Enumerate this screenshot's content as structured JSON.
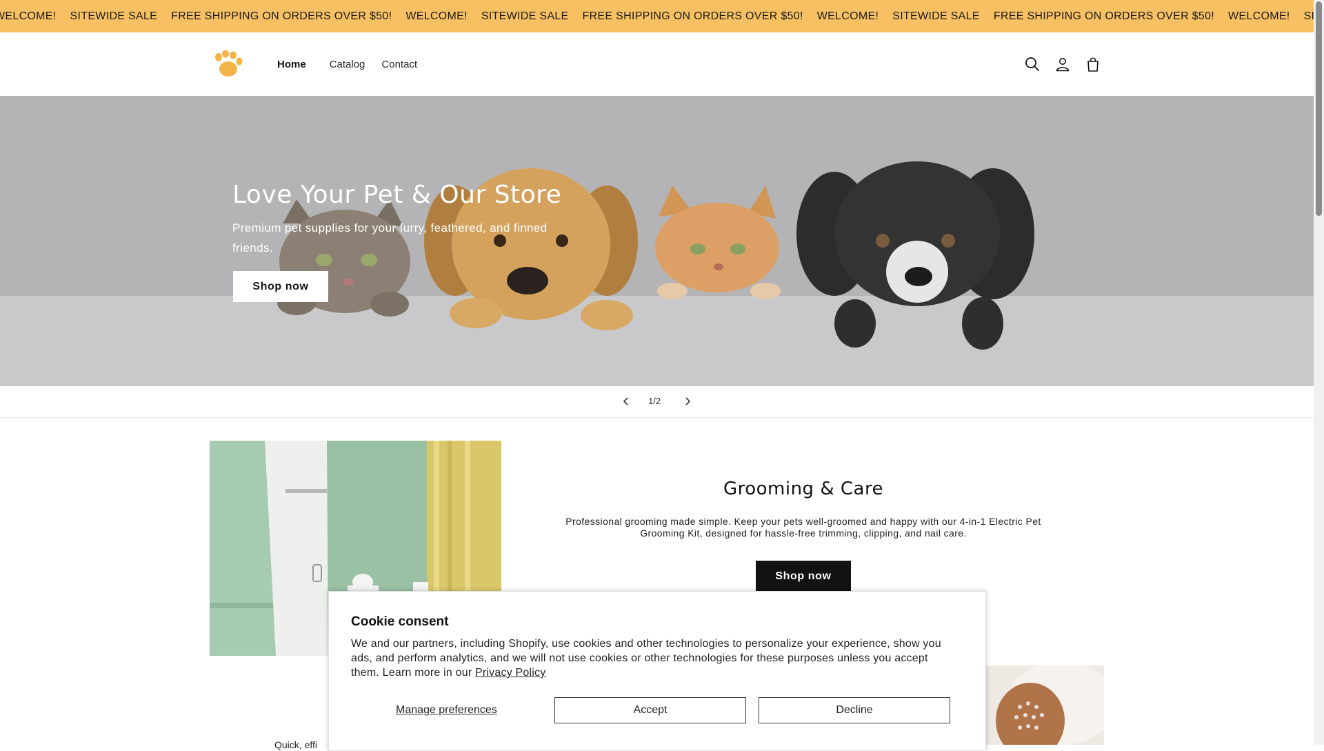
{
  "announcement": {
    "items": [
      "WELCOME!",
      "SITEWIDE SALE",
      "FREE SHIPPING ON ORDERS OVER $50!",
      "WELCOME!",
      "SITEWIDE SALE",
      "FREE SHIPPING ON ORDERS OVER $50!",
      "WELCOME!",
      "SITEWIDE SALE",
      "FREE SHIPPING ON ORDERS OVER $50!",
      "WELCOME!",
      "SITEWIDE SALE",
      "FREE SHIPPING ON ORDERS OVER $50!"
    ]
  },
  "header": {
    "logo_icon": "paw-icon",
    "nav": [
      {
        "label": "Home",
        "active": true
      },
      {
        "label": "Catalog",
        "active": false
      },
      {
        "label": "Contact",
        "active": false
      }
    ],
    "icons": [
      "search-icon",
      "account-icon",
      "cart-icon"
    ]
  },
  "hero": {
    "title": "Love Your Pet & Our Store",
    "subtitle": "Premium pet supplies for your furry, feathered, and finned friends.",
    "button": "Shop now"
  },
  "slider": {
    "counter": "1/2"
  },
  "feature": {
    "title": "Grooming & Care",
    "text": "Professional grooming made simple. Keep your pets well-groomed and happy with our 4-in-1 Electric Pet Grooming Kit, designed for hassle-free trimming, clipping, and nail care.",
    "button": "Shop now",
    "partial_text": "Quick, effi"
  },
  "cookie": {
    "title": "Cookie consent",
    "text": "We and our partners, including Shopify, use cookies and other technologies to personalize your experience, show you ads, and perform analytics, and we will not use cookies or other technologies for these purposes unless you accept them. Learn more in our",
    "link": "Privacy Policy",
    "manage": "Manage preferences",
    "accept": "Accept",
    "decline": "Decline"
  },
  "colors": {
    "announcement_bg": "#f6c063",
    "logo": "#f3b447",
    "hero_bg": "#b7b7b9"
  }
}
